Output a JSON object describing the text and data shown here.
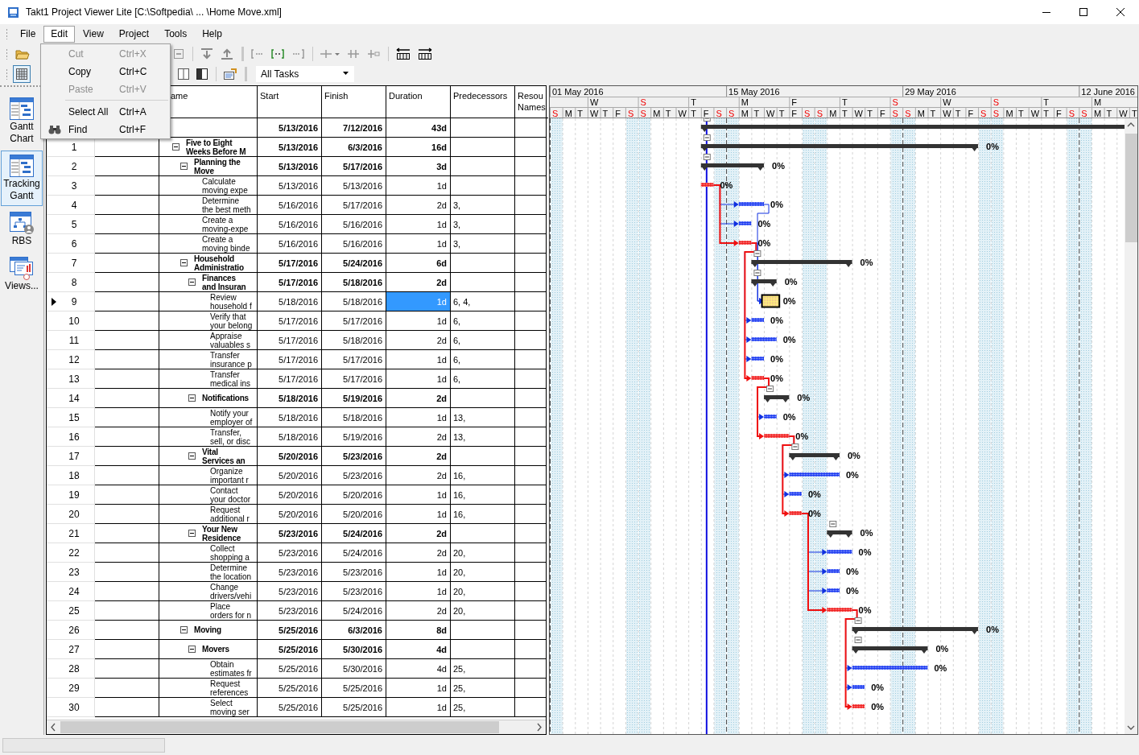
{
  "window": {
    "title": "Takt1 Project Viewer Lite [C:\\Softpedia\\ ... \\Home Move.xml]"
  },
  "menubar": [
    {
      "label": "File",
      "selected": false
    },
    {
      "label": "Edit",
      "selected": true
    },
    {
      "label": "View",
      "selected": false
    },
    {
      "label": "Project",
      "selected": false
    },
    {
      "label": "Tools",
      "selected": false
    },
    {
      "label": "Help",
      "selected": false
    }
  ],
  "edit_menu": [
    {
      "kind": "item",
      "label": "Cut",
      "shortcut": "Ctrl+X",
      "disabled": true,
      "has_icon": false
    },
    {
      "kind": "item",
      "label": "Copy",
      "shortcut": "Ctrl+C",
      "disabled": false,
      "has_icon": false
    },
    {
      "kind": "item",
      "label": "Paste",
      "shortcut": "Ctrl+V",
      "disabled": true,
      "has_icon": false
    },
    {
      "kind": "separator"
    },
    {
      "kind": "item",
      "label": "Select All",
      "shortcut": "Ctrl+A",
      "disabled": false,
      "has_icon": false
    },
    {
      "kind": "item",
      "label": "Find",
      "shortcut": "Ctrl+F",
      "disabled": false,
      "has_icon": true
    }
  ],
  "toolbar": {
    "grid_view_on": true,
    "filter": "All Tasks"
  },
  "sidebar": {
    "items": [
      {
        "label": "Gantt Chart",
        "kind": "gantt",
        "selected": false
      },
      {
        "label": "Tracking Gantt",
        "kind": "gantt",
        "selected": true
      },
      {
        "label": "RBS",
        "kind": "rbs",
        "selected": false
      },
      {
        "label": "Views...",
        "kind": "views",
        "selected": false
      }
    ]
  },
  "table": {
    "columns": [
      "ame",
      "Start",
      "Finish",
      "Duration",
      "Predecessors",
      "Resou Names"
    ],
    "rows": [
      {
        "id": "",
        "start": "5/13/2016",
        "finish": "7/12/2016",
        "duration": "43d",
        "selected": false,
        "children": [
          {
            "id": "1",
            "name": "Five to Eight\nWeeks Before M",
            "start": "5/13/2016",
            "finish": "6/3/2016",
            "duration": "16d",
            "complete": "0%",
            "expanded": true,
            "selected": false,
            "children": [
              {
                "id": "2",
                "name": "Planning the\nMove",
                "start": "5/13/2016",
                "finish": "5/17/2016",
                "duration": "3d",
                "complete": "0%",
                "expanded": true,
                "selected": false,
                "children": [
                  {
                    "id": "3",
                    "name": "Calculate\nmoving expe",
                    "start": "5/13/2016",
                    "finish": "5/13/2016",
                    "duration": "1d",
                    "complete": "0%",
                    "critical": true,
                    "selected": false
                  },
                  {
                    "id": "4",
                    "name": "Determine\nthe best meth",
                    "start": "5/16/2016",
                    "finish": "5/17/2016",
                    "duration": "2d",
                    "predecessors": "3,",
                    "complete": "0%",
                    "critical": false,
                    "selected": false
                  },
                  {
                    "id": "5",
                    "name": "Create a\nmoving-expe",
                    "start": "5/16/2016",
                    "finish": "5/16/2016",
                    "duration": "1d",
                    "predecessors": "3,",
                    "complete": "0%",
                    "critical": false,
                    "selected": false
                  },
                  {
                    "id": "6",
                    "name": "Create a\nmoving binde",
                    "start": "5/16/2016",
                    "finish": "5/16/2016",
                    "duration": "1d",
                    "predecessors": "3,",
                    "complete": "0%",
                    "critical": true,
                    "selected": false
                  }
                ]
              },
              {
                "id": "7",
                "name": "Household\nAdministratio",
                "start": "5/17/2016",
                "finish": "5/24/2016",
                "duration": "6d",
                "complete": "0%",
                "expanded": true,
                "selected": false,
                "children": [
                  {
                    "id": "8",
                    "name": "Finances\nand Insuran",
                    "start": "5/17/2016",
                    "finish": "5/18/2016",
                    "duration": "2d",
                    "complete": "0%",
                    "expanded": true,
                    "selected": false,
                    "children": [
                      {
                        "id": "9",
                        "name": "Review\nhousehold f",
                        "start": "5/18/2016",
                        "finish": "5/18/2016",
                        "duration": "1d",
                        "predecessors": "6, 4,",
                        "complete": "0%",
                        "critical": false,
                        "selected": true
                      },
                      {
                        "id": "10",
                        "name": "Verify that\nyour belong",
                        "start": "5/17/2016",
                        "finish": "5/17/2016",
                        "duration": "1d",
                        "predecessors": "6,",
                        "complete": "0%",
                        "critical": false,
                        "selected": false
                      },
                      {
                        "id": "11",
                        "name": "Appraise\nvaluables s",
                        "start": "5/17/2016",
                        "finish": "5/18/2016",
                        "duration": "2d",
                        "predecessors": "6,",
                        "complete": "0%",
                        "critical": false,
                        "selected": false
                      },
                      {
                        "id": "12",
                        "name": "Transfer\ninsurance p",
                        "start": "5/17/2016",
                        "finish": "5/17/2016",
                        "duration": "1d",
                        "predecessors": "6,",
                        "complete": "0%",
                        "critical": false,
                        "selected": false
                      },
                      {
                        "id": "13",
                        "name": "Transfer\nmedical ins",
                        "start": "5/17/2016",
                        "finish": "5/17/2016",
                        "duration": "1d",
                        "predecessors": "6,",
                        "complete": "0%",
                        "critical": true,
                        "selected": false
                      }
                    ]
                  },
                  {
                    "id": "14",
                    "name": "Notifications",
                    "start": "5/18/2016",
                    "finish": "5/19/2016",
                    "duration": "2d",
                    "complete": "0%",
                    "expanded": true,
                    "selected": false,
                    "children": [
                      {
                        "id": "15",
                        "name": "Notify your\nemployer of",
                        "start": "5/18/2016",
                        "finish": "5/18/2016",
                        "duration": "1d",
                        "predecessors": "13,",
                        "complete": "0%",
                        "critical": false,
                        "selected": false
                      },
                      {
                        "id": "16",
                        "name": "Transfer,\nsell, or disc",
                        "start": "5/18/2016",
                        "finish": "5/19/2016",
                        "duration": "2d",
                        "predecessors": "13,",
                        "complete": "0%",
                        "critical": true,
                        "selected": false
                      }
                    ]
                  },
                  {
                    "id": "17",
                    "name": "Vital\nServices an",
                    "start": "5/20/2016",
                    "finish": "5/23/2016",
                    "duration": "2d",
                    "complete": "0%",
                    "expanded": true,
                    "selected": false,
                    "children": [
                      {
                        "id": "18",
                        "name": "Organize\nimportant r",
                        "start": "5/20/2016",
                        "finish": "5/23/2016",
                        "duration": "2d",
                        "predecessors": "16,",
                        "complete": "0%",
                        "critical": false,
                        "selected": false
                      },
                      {
                        "id": "19",
                        "name": "Contact\nyour doctor",
                        "start": "5/20/2016",
                        "finish": "5/20/2016",
                        "duration": "1d",
                        "predecessors": "16,",
                        "complete": "0%",
                        "critical": false,
                        "selected": false
                      },
                      {
                        "id": "20",
                        "name": "Request\nadditional r",
                        "start": "5/20/2016",
                        "finish": "5/20/2016",
                        "duration": "1d",
                        "predecessors": "16,",
                        "complete": "0%",
                        "critical": true,
                        "selected": false
                      }
                    ]
                  },
                  {
                    "id": "21",
                    "name": "Your New\nResidence",
                    "start": "5/23/2016",
                    "finish": "5/24/2016",
                    "duration": "2d",
                    "complete": "0%",
                    "expanded": true,
                    "selected": false,
                    "children": [
                      {
                        "id": "22",
                        "name": "Collect\nshopping a",
                        "start": "5/23/2016",
                        "finish": "5/24/2016",
                        "duration": "2d",
                        "predecessors": "20,",
                        "complete": "0%",
                        "critical": false,
                        "selected": false
                      },
                      {
                        "id": "23",
                        "name": "Determine\nthe location",
                        "start": "5/23/2016",
                        "finish": "5/23/2016",
                        "duration": "1d",
                        "predecessors": "20,",
                        "complete": "0%",
                        "critical": false,
                        "selected": false
                      },
                      {
                        "id": "24",
                        "name": "Change\ndrivers/vehi",
                        "start": "5/23/2016",
                        "finish": "5/23/2016",
                        "duration": "1d",
                        "predecessors": "20,",
                        "complete": "0%",
                        "critical": false,
                        "selected": false
                      },
                      {
                        "id": "25",
                        "name": "Place\norders for n",
                        "start": "5/23/2016",
                        "finish": "5/24/2016",
                        "duration": "2d",
                        "predecessors": "20,",
                        "complete": "0%",
                        "critical": true,
                        "selected": false
                      }
                    ]
                  }
                ]
              },
              {
                "id": "26",
                "name": "Moving",
                "start": "5/25/2016",
                "finish": "6/3/2016",
                "duration": "8d",
                "complete": "0%",
                "expanded": true,
                "selected": false,
                "children": [
                  {
                    "id": "27",
                    "name": "Movers",
                    "start": "5/25/2016",
                    "finish": "5/30/2016",
                    "duration": "4d",
                    "complete": "0%",
                    "expanded": true,
                    "selected": false,
                    "children": [
                      {
                        "id": "28",
                        "name": "Obtain\nestimates fr",
                        "start": "5/25/2016",
                        "finish": "5/30/2016",
                        "duration": "4d",
                        "predecessors": "25,",
                        "complete": "0%",
                        "critical": false,
                        "selected": false
                      },
                      {
                        "id": "29",
                        "name": "Request\nreferences",
                        "start": "5/25/2016",
                        "finish": "5/25/2016",
                        "duration": "1d",
                        "predecessors": "25,",
                        "complete": "0%",
                        "critical": false,
                        "selected": false
                      },
                      {
                        "id": "30",
                        "name": "Select\nmoving ser",
                        "start": "5/25/2016",
                        "finish": "5/25/2016",
                        "duration": "1d",
                        "predecessors": "25,",
                        "complete": "0%",
                        "critical": true,
                        "selected": false
                      }
                    ]
                  }
                ]
              }
            ]
          }
        ]
      }
    ]
  },
  "gantt": {
    "months": [
      "01 May 2016",
      "15 May 2016",
      "29 May 2016",
      "12 June 2016"
    ],
    "weekdays": [
      {
        "letter": "W",
        "weekend": false
      },
      {
        "letter": "S",
        "weekend": true
      },
      {
        "letter": "T",
        "weekend": false
      },
      {
        "letter": "M",
        "weekend": false
      },
      {
        "letter": "F",
        "weekend": false
      },
      {
        "letter": "T",
        "weekend": false
      },
      {
        "letter": "S",
        "weekend": true
      },
      {
        "letter": "W",
        "weekend": false
      },
      {
        "letter": "S",
        "weekend": true
      },
      {
        "letter": "T",
        "weekend": false
      },
      {
        "letter": "M",
        "weekend": false
      }
    ],
    "days": [
      {
        "letter": "S",
        "weekend": true
      },
      {
        "letter": "M",
        "weekend": false
      },
      {
        "letter": "T",
        "weekend": false
      },
      {
        "letter": "W",
        "weekend": false
      },
      {
        "letter": "T",
        "weekend": false
      },
      {
        "letter": "F",
        "weekend": false
      },
      {
        "letter": "S",
        "weekend": true
      },
      {
        "letter": "S",
        "weekend": true
      },
      {
        "letter": "M",
        "weekend": false
      },
      {
        "letter": "T",
        "weekend": false
      },
      {
        "letter": "W",
        "weekend": false
      },
      {
        "letter": "T",
        "weekend": false
      },
      {
        "letter": "F",
        "weekend": false
      },
      {
        "letter": "S",
        "weekend": true
      },
      {
        "letter": "S",
        "weekend": true
      },
      {
        "letter": "M",
        "weekend": false
      },
      {
        "letter": "T",
        "weekend": false
      },
      {
        "letter": "W",
        "weekend": false
      },
      {
        "letter": "T",
        "weekend": false
      },
      {
        "letter": "F",
        "weekend": false
      },
      {
        "letter": "S",
        "weekend": true
      },
      {
        "letter": "S",
        "weekend": true
      },
      {
        "letter": "M",
        "weekend": false
      },
      {
        "letter": "T",
        "weekend": false
      },
      {
        "letter": "W",
        "weekend": false
      },
      {
        "letter": "T",
        "weekend": false
      },
      {
        "letter": "F",
        "weekend": false
      },
      {
        "letter": "S",
        "weekend": true
      },
      {
        "letter": "S",
        "weekend": true
      },
      {
        "letter": "M",
        "weekend": false
      },
      {
        "letter": "T",
        "weekend": false
      },
      {
        "letter": "W",
        "weekend": false
      },
      {
        "letter": "T",
        "weekend": false
      },
      {
        "letter": "F",
        "weekend": false
      },
      {
        "letter": "S",
        "weekend": true
      },
      {
        "letter": "S",
        "weekend": true
      },
      {
        "letter": "M",
        "weekend": false
      },
      {
        "letter": "T",
        "weekend": false
      },
      {
        "letter": "W",
        "weekend": false
      },
      {
        "letter": "T",
        "weekend": false
      },
      {
        "letter": "F",
        "weekend": false
      },
      {
        "letter": "S",
        "weekend": true
      },
      {
        "letter": "S",
        "weekend": true
      },
      {
        "letter": "M",
        "weekend": false
      },
      {
        "letter": "T",
        "weekend": false
      },
      {
        "letter": "W",
        "weekend": false
      },
      {
        "letter": "T",
        "weekend": false
      }
    ]
  }
}
